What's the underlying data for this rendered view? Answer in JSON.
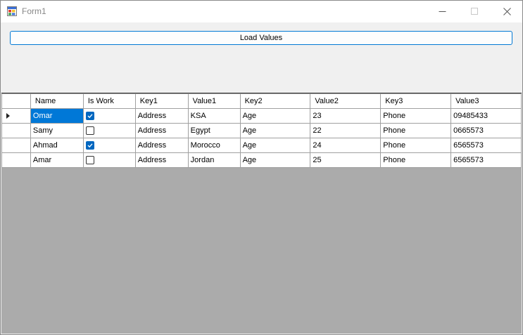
{
  "window": {
    "title": "Form1"
  },
  "toolbar": {
    "load_label": "Load Values"
  },
  "grid": {
    "columns": [
      "Name",
      "Is Work",
      "Key1",
      "Value1",
      "Key2",
      "Value2",
      "Key3",
      "Value3"
    ],
    "rows": [
      {
        "name": "Omar",
        "is_work": true,
        "key1": "Address",
        "value1": "KSA",
        "key2": "Age",
        "value2": "23",
        "key3": "Phone",
        "value3": "09485433"
      },
      {
        "name": "Samy",
        "is_work": false,
        "key1": "Address",
        "value1": "Egypt",
        "key2": "Age",
        "value2": "22",
        "key3": "Phone",
        "value3": "0665573"
      },
      {
        "name": "Ahmad",
        "is_work": true,
        "key1": "Address",
        "value1": "Morocco",
        "key2": "Age",
        "value2": "24",
        "key3": "Phone",
        "value3": "6565573"
      },
      {
        "name": "Amar",
        "is_work": false,
        "key1": "Address",
        "value1": "Jordan",
        "key2": "Age",
        "value2": "25",
        "key3": "Phone",
        "value3": "6565573"
      }
    ]
  },
  "icons": {
    "app": "form-app-icon",
    "minimize": "minimize-icon",
    "maximize": "maximize-icon",
    "close": "close-icon",
    "current_row": "current-row-arrow-icon",
    "check": "checkmark-icon"
  },
  "colors": {
    "accent": "#0078d4",
    "selection": "#0078d7",
    "grid_background": "#ababab"
  }
}
